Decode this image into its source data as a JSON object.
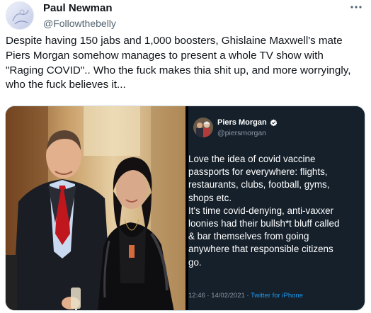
{
  "user": {
    "display_name": "Paul Newman",
    "handle": "@Followthebelly"
  },
  "more_icon": "more-horizontal-icon",
  "tweet": {
    "text": "Despite having 150 jabs and 1,000 boosters, Ghislaine Maxwell's mate Piers Morgan somehow manages to present a whole TV show with \"Raging COVID\".. Who the fuck makes thia shit up, and more worryingly, who the fuck believes it..."
  },
  "media": {
    "embedded_tweet": {
      "display_name": "Piers Morgan",
      "verified_icon": "verified-badge-icon",
      "handle": "@piersmorgan",
      "text": "Love the idea of covid vaccine\npassports for everywhere: flights,\nrestaurants, clubs, football, gyms,\nshops etc.\nIt's time covid-denying, anti-vaxxer\nloonies had their bullsh*t bluff called\n& bar themselves from going\nanywhere that responsible citizens\ngo.",
      "timestamp": "12:46 · 14/02/2021 · ",
      "source": "Twitter for iPhone"
    }
  },
  "colors": {
    "text_primary": "#0f1419",
    "text_secondary": "#536471",
    "dark_card_bg": "#15202b",
    "link_blue": "#1d9bf0"
  }
}
